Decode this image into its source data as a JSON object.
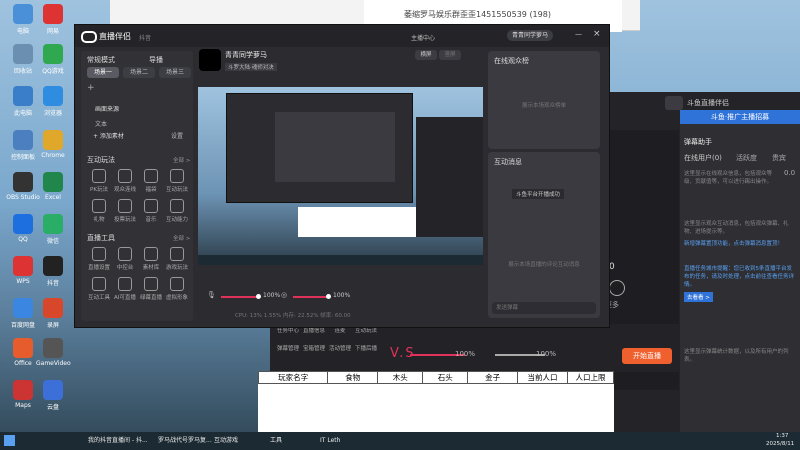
{
  "desktop": {
    "icons": [
      {
        "label": "电脑",
        "color": "#4a90d9"
      },
      {
        "label": "网易",
        "color": "#d33"
      },
      {
        "label": "回收站",
        "color": "#6b8fb0"
      },
      {
        "label": "QQ游戏",
        "color": "#2fa84f"
      },
      {
        "label": "此电脑",
        "color": "#3a7ec9"
      },
      {
        "label": "浏览器",
        "color": "#2e8de0"
      },
      {
        "label": "控制面板",
        "color": "#4c7fc0"
      },
      {
        "label": "Chrome",
        "color": "#e0a82a"
      },
      {
        "label": "OBS Studio",
        "color": "#333"
      },
      {
        "label": "Excel",
        "color": "#21864b"
      },
      {
        "label": "QQ",
        "color": "#1d6fe0"
      },
      {
        "label": "微信",
        "color": "#2aae67"
      },
      {
        "label": "WPS",
        "color": "#d33"
      },
      {
        "label": "抖音",
        "color": "#222"
      },
      {
        "label": "百度网盘",
        "color": "#3b86e0"
      },
      {
        "label": "录屏",
        "color": "#d9472b"
      },
      {
        "label": "Office",
        "color": "#e65c2c"
      },
      {
        "label": "GameVideo",
        "color": "#555"
      },
      {
        "label": "Maps",
        "color": "#c33"
      },
      {
        "label": "云盘",
        "color": "#3c6fd8"
      }
    ]
  },
  "bg_window": {
    "title": "萎缩罗马娱乐群歪歪1451550539 (198)"
  },
  "main_window": {
    "title": "直播伴侣",
    "subtitle": "抖音",
    "status": "主播中心",
    "user": "青青同学萝马",
    "mode_label": "常规模式",
    "guide_label": "导播",
    "scenes": [
      "场景一",
      "场景二",
      "场景三"
    ],
    "sources_header": "画面来源",
    "source_items": [
      "文本"
    ],
    "add_material": "+ 添加素材",
    "settings": "设置",
    "interactive_header": "互动玩法",
    "all_label": "全部 >",
    "interactive_tools": [
      "PK玩法",
      "观众连线",
      "福袋",
      "互动玩法",
      "礼物",
      "投票玩法",
      "音乐",
      "互动能力"
    ],
    "live_tools_header": "直播工具",
    "live_tools": [
      "直播设置",
      "中控台",
      "素材库",
      "游戏玩法",
      "互动工具",
      "AI可直播",
      "绿幕直播",
      "虚拟形象"
    ],
    "anchor_name": "青青同学萝马",
    "anchor_tag": "斗罗大陆·魂师对决",
    "tabs": [
      "横屏",
      "竖屏",
      "横屏"
    ],
    "online_header": "在线观众榜",
    "online_empty": "展示本场观众榜单",
    "interact_header": "互动消息",
    "interact_toast": "斗鱼平台开播成功",
    "interact_empty": "展示本场直播的评论互动消息",
    "chat_placeholder": "发送弹幕",
    "vol1": "100%",
    "vol2": "100%",
    "stats": "CPU: 13%  1.55%  内存: 22.52%  帧率: 60.00",
    "start_label": "开始直播"
  },
  "right_window": {
    "title": "斗鱼直播伴侣",
    "banner": "斗鱼·推广主播招募",
    "tabs": [
      "弹幕助手"
    ],
    "sub_tabs": [
      "在线用户(0)",
      "活跃度",
      "贵宾"
    ],
    "value_a": "0.0",
    "desc1": "这里显示在线观众信息，包括观众等级、贡献值等，可以进行踢出操作。",
    "desc2": "这里显示观众互动消息，包括观众弹幕、礼物、进场提示等。",
    "tip1": "新增弹幕置顶功能，点击弹幕消息置顶！",
    "tip2": "直播任务城市提醒：您已收到5条直播平台发布的任务，请及时处理，点击前往查看任务详情。",
    "tip_link": "去看看 >",
    "bottom_desc": "这里显示弹幕统计数据，以及所有用户的列表。",
    "count": "0",
    "more": "更多",
    "start_live": "开始直播",
    "vol": "100%",
    "vol2": "100%",
    "bottom_tools": [
      "弹幕管理",
      "宝箱管理",
      "活动管理",
      "下播后播",
      "任务中心",
      "直播信息",
      "连麦",
      "互动玩法"
    ]
  },
  "red_text": "V.S",
  "table": {
    "headers": [
      "玩家名字",
      "食物",
      "木头",
      "石头",
      "金子",
      "当前人口",
      "人口上限"
    ]
  },
  "taskbar": {
    "items": [
      "我的抖音直播间 - 抖...",
      "罗马战代号罗马复...",
      "互动游戏",
      "工具",
      "IT Leth"
    ],
    "time": "1:37",
    "date": "2025/8/11"
  },
  "colors": {
    "accent": "#e0315a",
    "start_button": "#f0602f",
    "banner_blue": "#2f73d9"
  }
}
